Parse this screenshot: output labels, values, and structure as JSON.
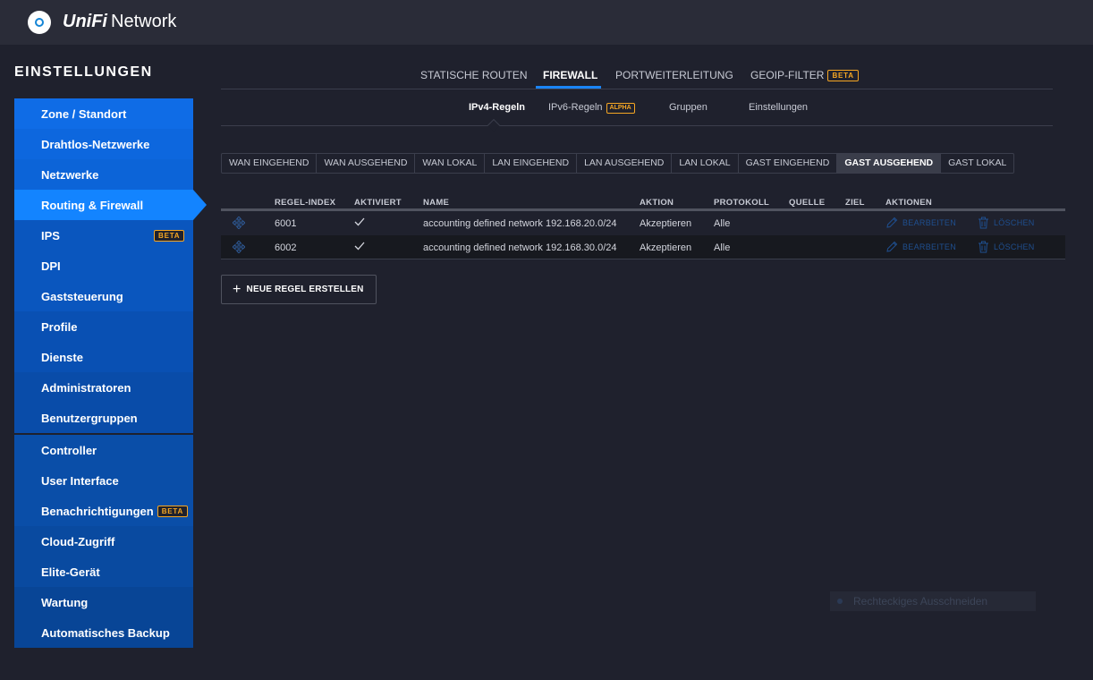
{
  "header": {
    "brand_a": "UniFi",
    "brand_b": "Network",
    "logo": "unifi-logo-icon"
  },
  "sidebar": {
    "title": "EINSTELLUNGEN",
    "group1": [
      {
        "label": "Zone / Standort"
      },
      {
        "label": "Drahtlos-Netzwerke"
      },
      {
        "label": "Netzwerke"
      },
      {
        "label": "Routing & Firewall",
        "active": true
      },
      {
        "label": "IPS",
        "badge": "BETA"
      },
      {
        "label": "DPI"
      },
      {
        "label": "Gaststeuerung"
      },
      {
        "label": "Profile"
      },
      {
        "label": "Dienste"
      },
      {
        "label": "Administratoren"
      },
      {
        "label": "Benutzergruppen"
      }
    ],
    "group2": [
      {
        "label": "Controller"
      },
      {
        "label": "User Interface"
      },
      {
        "label": "Benachrichtigungen",
        "badge": "BETA"
      },
      {
        "label": "Cloud-Zugriff"
      },
      {
        "label": "Elite-Gerät"
      },
      {
        "label": "Wartung"
      },
      {
        "label": "Automatisches Backup"
      }
    ]
  },
  "main_tabs": {
    "static_routes": "STATISCHE ROUTEN",
    "firewall": "FIREWALL",
    "port_forwarding": "PORTWEITERLEITUNG",
    "geoip": "GEOIP-FILTER",
    "geoip_badge": "BETA"
  },
  "sub_tabs": {
    "ipv4": "IPv4-Regeln",
    "ipv6": "IPv6-Regeln",
    "ipv6_badge": "ALPHA",
    "groups": "Gruppen",
    "settings": "Einstellungen"
  },
  "category_tabs": [
    "WAN EINGEHEND",
    "WAN AUSGEHEND",
    "WAN LOKAL",
    "LAN EINGEHEND",
    "LAN AUSGEHEND",
    "LAN LOKAL",
    "GAST EINGEHEND",
    "GAST AUSGEHEND",
    "GAST LOKAL"
  ],
  "category_active": "GAST AUSGEHEND",
  "table": {
    "headers": {
      "index": "REGEL-INDEX",
      "enabled": "AKTIVIERT",
      "name": "NAME",
      "action": "AKTION",
      "protocol": "PROTOKOLL",
      "source": "QUELLE",
      "dest": "ZIEL",
      "actions": "AKTIONEN"
    },
    "rows": [
      {
        "index": "6001",
        "enabled": true,
        "name": "accounting defined network 192.168.20.0/24",
        "action": "Akzeptieren",
        "protocol": "Alle",
        "source": "",
        "dest": ""
      },
      {
        "index": "6002",
        "enabled": true,
        "name": "accounting defined network 192.168.30.0/24",
        "action": "Akzeptieren",
        "protocol": "Alle",
        "source": "",
        "dest": ""
      }
    ],
    "edit_label": "BEARBEITEN",
    "delete_label": "LÖSCHEN"
  },
  "new_rule_button": "NEUE REGEL ERSTELLEN",
  "snip_overlay": "Rechteckiges Ausschneiden"
}
